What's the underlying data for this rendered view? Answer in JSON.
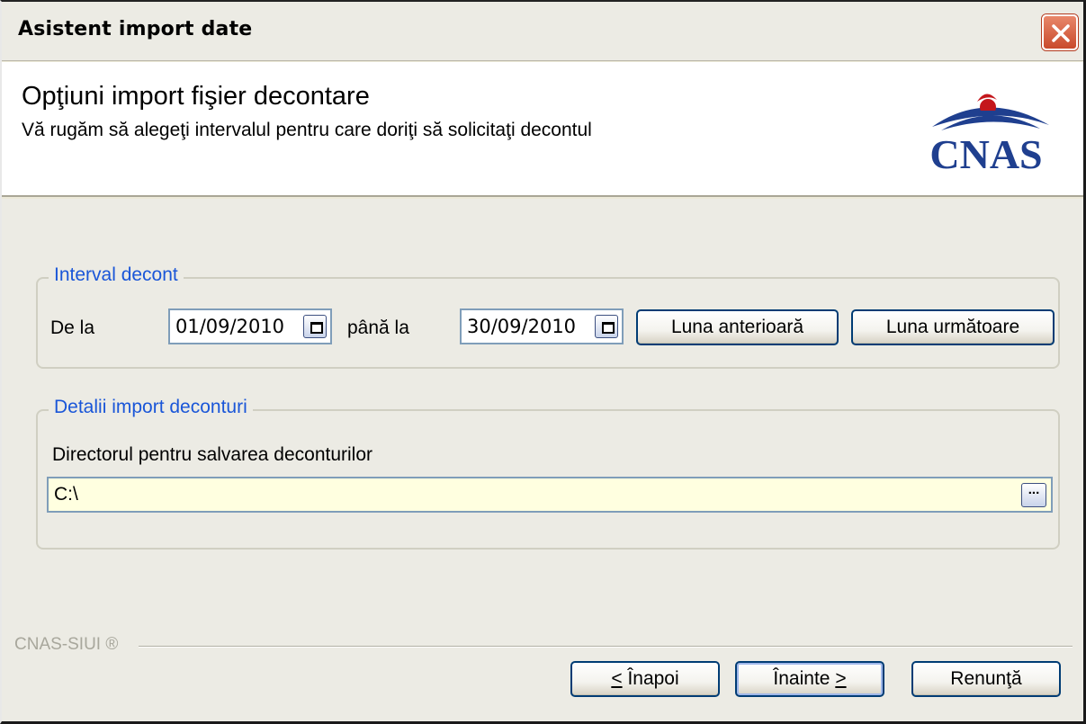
{
  "window": {
    "title": "Asistent import date"
  },
  "header": {
    "title": "Opţiuni import fişier decontare",
    "subtitle": "Vă rugăm să alegeţi intervalul pentru care doriţi să solicitaţi decontul",
    "logo_text": "CNAS"
  },
  "interval": {
    "legend": "Interval decont",
    "from_label": "De la",
    "from_value": "01/09/2010",
    "to_label": "până la",
    "to_value": "30/09/2010",
    "prev_month_button": "Luna anterioară",
    "next_month_button": "Luna următoare"
  },
  "details": {
    "legend": "Detalii import deconturi",
    "dir_label": "Directorul pentru salvarea deconturilor",
    "dir_value": "C:\\",
    "browse_label": "..."
  },
  "footer": {
    "brand": "CNAS-SIUI ®",
    "back_label": "Înapoi",
    "back_prefix": "<",
    "next_label": "Înainte",
    "next_suffix": ">",
    "cancel_label": "Renunţă"
  },
  "colors": {
    "accent": "#1a56d8",
    "logo_blue": "#1f3f8f",
    "logo_red": "#c4161c",
    "input_bg": "#ffffe0"
  }
}
